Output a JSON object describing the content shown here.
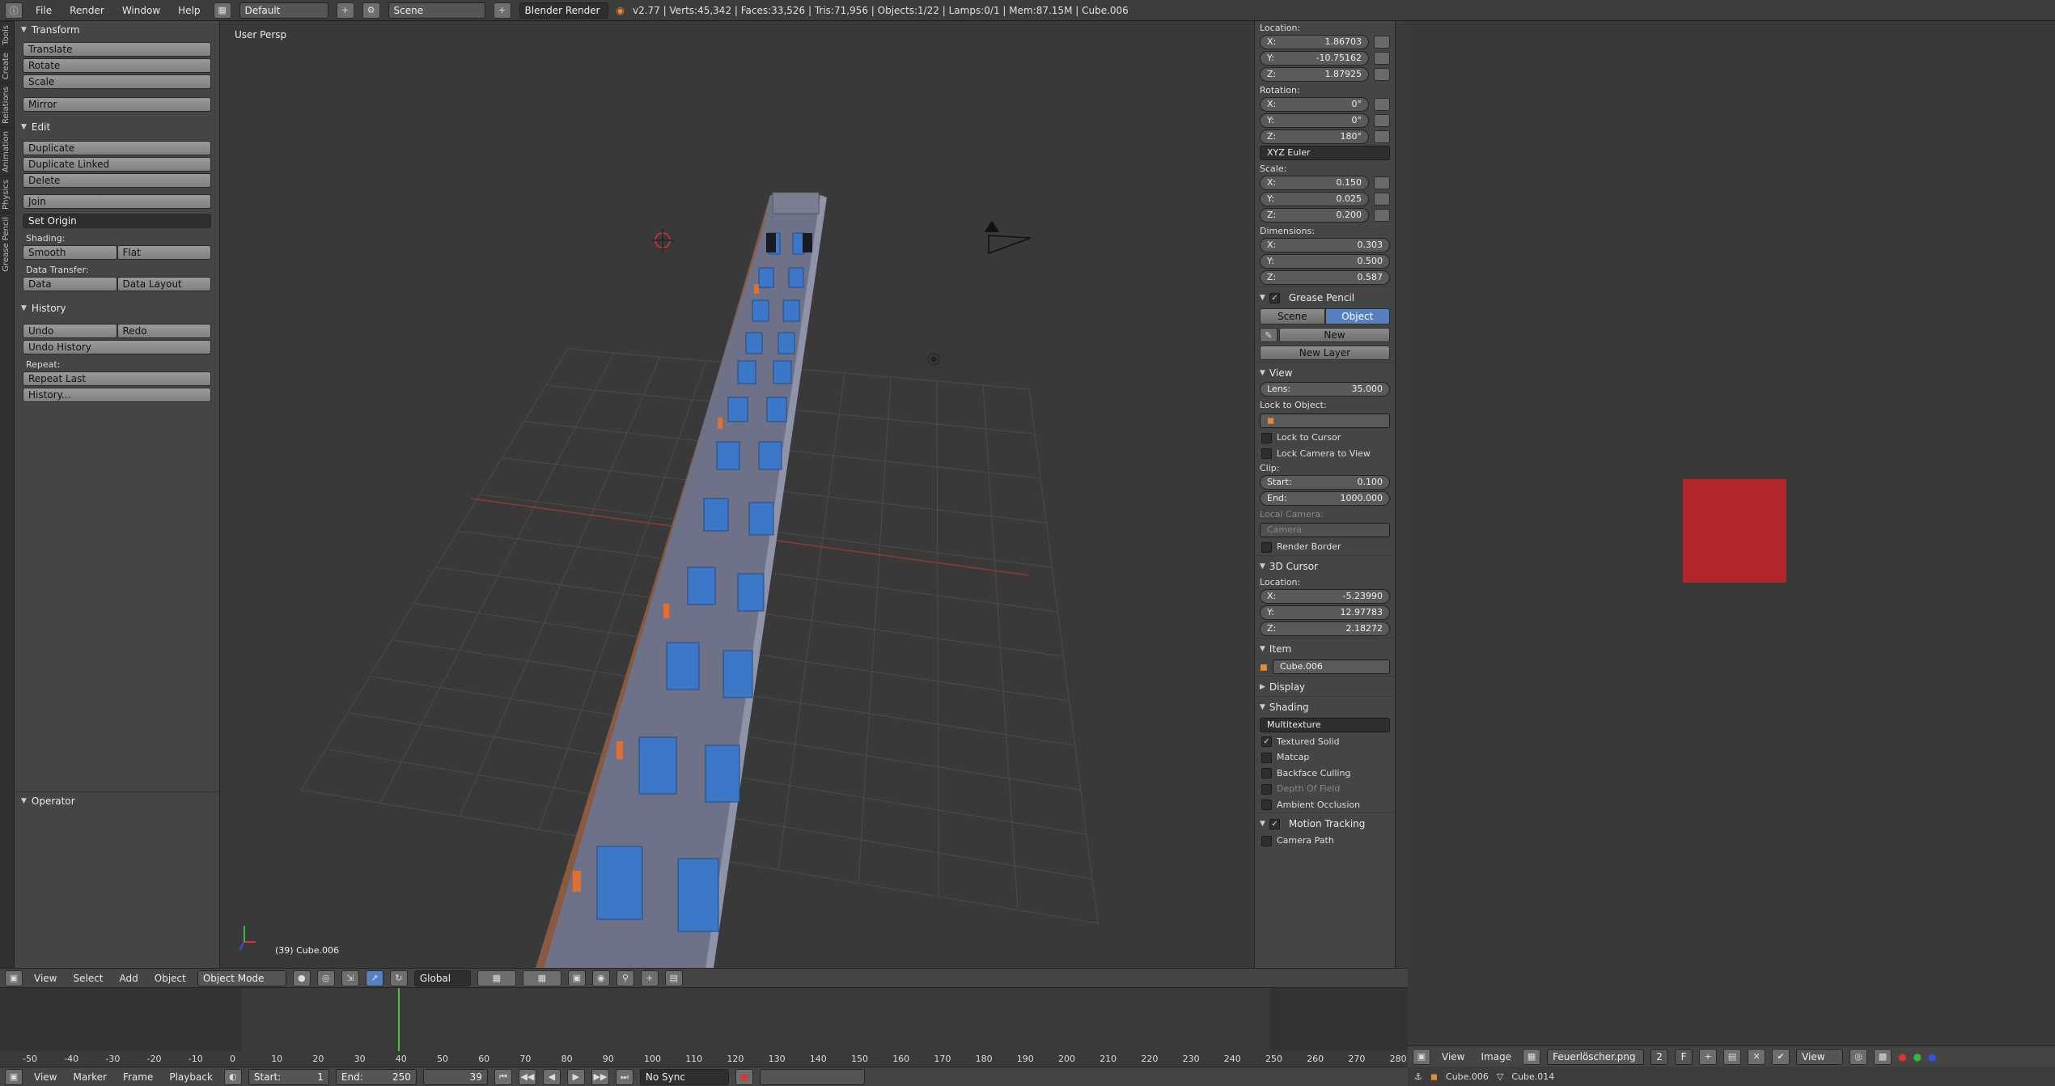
{
  "topbar": {
    "menus": [
      "File",
      "Render",
      "Window",
      "Help"
    ],
    "layout": "Default",
    "scene": "Scene",
    "engine": "Blender Render",
    "stats": "v2.77 | Verts:45,342 | Faces:33,526 | Tris:71,956 | Objects:1/22 | Lamps:0/1 | Mem:87.15M | Cube.006"
  },
  "lefttabs": [
    "Tools",
    "Create",
    "Relations",
    "Animation",
    "Physics",
    "Grease Pencil"
  ],
  "toolshelf": {
    "transform_title": "Transform",
    "transform": [
      "Translate",
      "Rotate",
      "Scale"
    ],
    "mirror": "Mirror",
    "edit_title": "Edit",
    "edit": [
      "Duplicate",
      "Duplicate Linked",
      "Delete"
    ],
    "join": "Join",
    "set_origin": "Set Origin",
    "shading_label": "Shading:",
    "smooth": "Smooth",
    "flat": "Flat",
    "data_transfer_label": "Data Transfer:",
    "data": "Data",
    "data_layout": "Data Layout",
    "history_title": "History",
    "undo": "Undo",
    "redo": "Redo",
    "undo_history": "Undo History",
    "repeat_label": "Repeat:",
    "repeat_last": "Repeat Last",
    "history": "History...",
    "operator_title": "Operator"
  },
  "viewport": {
    "view_label": "User Persp",
    "object_label": "(39) Cube.006"
  },
  "props": {
    "location_label": "Location:",
    "loc": [
      {
        "axis": "X:",
        "val": "1.86703"
      },
      {
        "axis": "Y:",
        "val": "-10.75162"
      },
      {
        "axis": "Z:",
        "val": "1.87925"
      }
    ],
    "rotation_label": "Rotation:",
    "rot": [
      {
        "axis": "X:",
        "val": "0°"
      },
      {
        "axis": "Y:",
        "val": "0°"
      },
      {
        "axis": "Z:",
        "val": "180°"
      }
    ],
    "euler": "XYZ Euler",
    "scale_label": "Scale:",
    "scale": [
      {
        "axis": "X:",
        "val": "0.150"
      },
      {
        "axis": "Y:",
        "val": "0.025"
      },
      {
        "axis": "Z:",
        "val": "0.200"
      }
    ],
    "dimensions_label": "Dimensions:",
    "dim": [
      {
        "axis": "X:",
        "val": "0.303"
      },
      {
        "axis": "Y:",
        "val": "0.500"
      },
      {
        "axis": "Z:",
        "val": "0.587"
      }
    ],
    "grease_pencil": "Grease Pencil",
    "gp_scene": "Scene",
    "gp_object": "Object",
    "gp_new": "New",
    "gp_new_layer": "New Layer",
    "view_title": "View",
    "lens_label": "Lens:",
    "lens": "35.000",
    "lock_to_object": "Lock to Object:",
    "lock_to_cursor": "Lock to Cursor",
    "lock_camera": "Lock Camera to View",
    "clip_label": "Clip:",
    "clip_start_label": "Start:",
    "clip_start": "0.100",
    "clip_end_label": "End:",
    "clip_end": "1000.000",
    "local_camera": "Local Camera:",
    "camera": "Camera",
    "render_border": "Render Border",
    "cursor_title": "3D Cursor",
    "cursor_location": "Location:",
    "cursor": [
      {
        "axis": "X:",
        "val": "-5.23990"
      },
      {
        "axis": "Y:",
        "val": "12.97783"
      },
      {
        "axis": "Z:",
        "val": "2.18272"
      }
    ],
    "item_title": "Item",
    "item_name": "Cube.006",
    "display_title": "Display",
    "shading_title": "Shading",
    "shading_mode": "Multitexture",
    "textured_solid": "Textured Solid",
    "matcap": "Matcap",
    "backface": "Backface Culling",
    "dof": "Depth Of Field",
    "ao": "Ambient Occlusion",
    "motion_tracking": "Motion Tracking",
    "camera_path": "Camera Path"
  },
  "vpheader": {
    "menus": [
      "View",
      "Select",
      "Add",
      "Object"
    ],
    "mode": "Object Mode",
    "orientation": "Global"
  },
  "timeline": {
    "ticks": [
      "-50",
      "-40",
      "-30",
      "-20",
      "-10",
      "0",
      "10",
      "20",
      "30",
      "40",
      "50",
      "60",
      "70",
      "80",
      "90",
      "100",
      "110",
      "120",
      "130",
      "140",
      "150",
      "160",
      "170",
      "180",
      "190",
      "200",
      "210",
      "220",
      "230",
      "240",
      "250",
      "260",
      "270",
      "280"
    ],
    "current_frame": 39,
    "menus": [
      "View",
      "Marker",
      "Frame",
      "Playback"
    ],
    "start_label": "Start:",
    "start": "1",
    "end_label": "End:",
    "end": "250",
    "frame": "39",
    "sync": "No Sync"
  },
  "imgbar": {
    "menus": [
      "View",
      "Image"
    ],
    "image_name": "Feuerlöscher.png",
    "users": "2",
    "fake": "F",
    "view": "View"
  },
  "statusline": {
    "obj1": "Cube.006",
    "obj2": "Cube.014"
  },
  "colors": {
    "image_swatch": "#b5262b",
    "accent": "#5680c2",
    "frame_marker": "#4ec23a"
  }
}
